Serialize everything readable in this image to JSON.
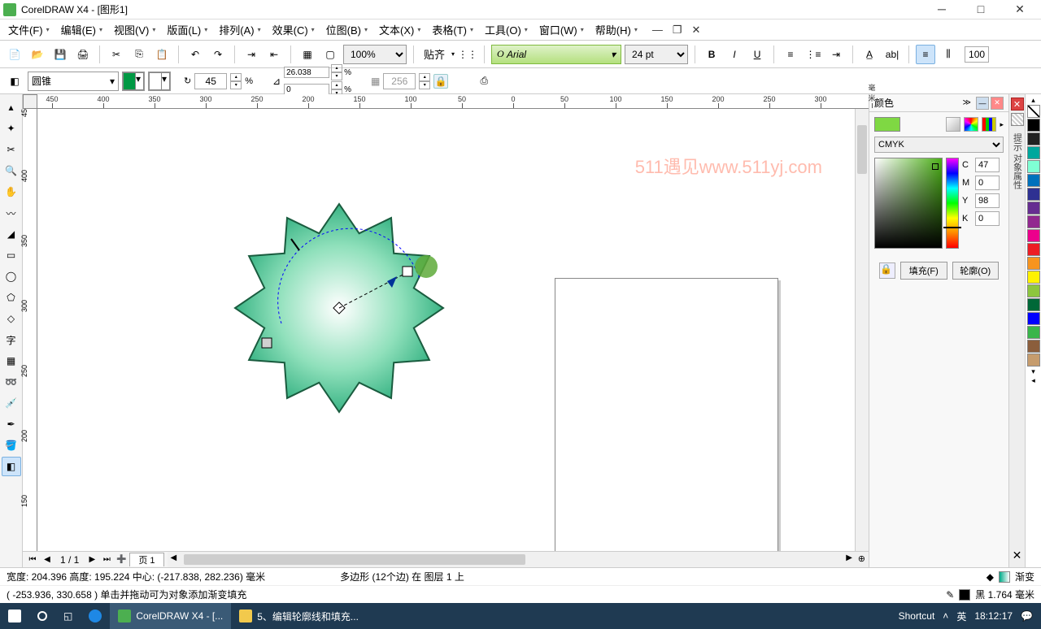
{
  "title": "CorelDRAW X4 - [图形1]",
  "menu": [
    "文件(F)",
    "编辑(E)",
    "视图(V)",
    "版面(L)",
    "排列(A)",
    "效果(C)",
    "位图(B)",
    "文本(X)",
    "表格(T)",
    "工具(O)",
    "窗口(W)",
    "帮助(H)"
  ],
  "toolbar": {
    "zoom": "100%",
    "snap_label": "贴齐",
    "font": "Arial",
    "font_size": "24 pt",
    "end_num": "100"
  },
  "propbar": {
    "style": "圆锥",
    "angle": "45",
    "coord_x": "26.038",
    "coord_y": "0",
    "blend": "256"
  },
  "docker": {
    "title": "颜色",
    "model": "CMYK",
    "c": "47",
    "m": "0",
    "y": "98",
    "k": "0",
    "fill_btn": "填充(F)",
    "outline_btn": "轮廓(O)"
  },
  "side_tab_text": "提示 对象属性",
  "ruler_h": [
    "450",
    "400",
    "350",
    "300",
    "250",
    "200",
    "150",
    "100",
    "50",
    "0",
    "50",
    "100",
    "150",
    "200",
    "250",
    "300",
    "毫米"
  ],
  "ruler_v": [
    "45",
    "400",
    "350",
    "300",
    "250",
    "200",
    "150"
  ],
  "palette_colors": [
    "none",
    "#000000",
    "#222222",
    "#00a79d",
    "#7fffd4",
    "#0071bc",
    "#2e3192",
    "#662d91",
    "#92278f",
    "#ec008c",
    "#ed1c24",
    "#f7941e",
    "#fff200",
    "#8dc63e",
    "#006838",
    "#0000ff",
    "#39b54a",
    "#8b5e3c",
    "#c69c6d"
  ],
  "page_nav": {
    "pages": "1 / 1",
    "tab": "页 1"
  },
  "status": {
    "line1_left": "宽度: 204.396  高度: 195.224  中心: (-217.838, 282.236)  毫米",
    "line1_mid": "多边形 (12个边) 在 图层 1 上",
    "line1_right_label": "渐变",
    "line2_left": "( -253.936, 330.658 )   单击并拖动可为对象添加渐变填充",
    "line2_right": "黑  1.764 毫米"
  },
  "taskbar": {
    "app1": "CorelDRAW X4 - [...",
    "app2": "5、编辑轮廓线和填充...",
    "shortcut": "Shortcut",
    "ime": "英",
    "time": "18:12:17"
  },
  "watermark": "511遇见www.511yj.com"
}
